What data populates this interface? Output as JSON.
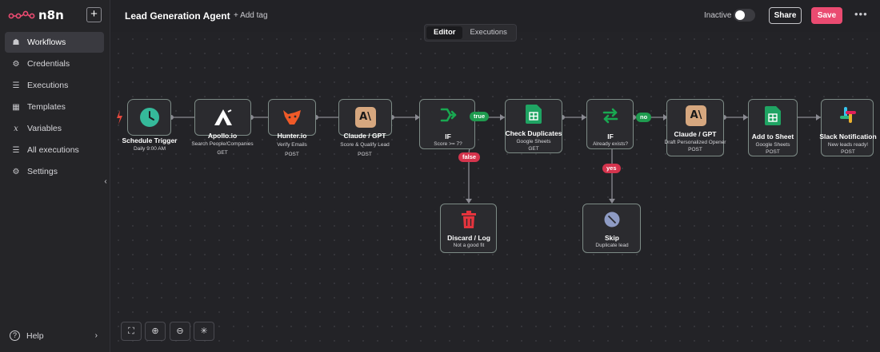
{
  "app": {
    "name": "n8n"
  },
  "sidebar": {
    "items": [
      {
        "label": "Workflows",
        "icon": "workflow-icon",
        "active": true
      },
      {
        "label": "Credentials",
        "icon": "key-icon"
      },
      {
        "label": "Executions",
        "icon": "list-icon"
      },
      {
        "label": "Templates",
        "icon": "template-icon"
      },
      {
        "label": "Variables",
        "icon": "variable-icon"
      },
      {
        "label": "All executions",
        "icon": "list-icon"
      },
      {
        "label": "Settings",
        "icon": "gear-icon"
      }
    ],
    "help": "Help"
  },
  "header": {
    "title": "Lead Generation Agent",
    "add_tag": "+ Add tag",
    "status": "Inactive",
    "share": "Share",
    "save": "Save"
  },
  "canvas": {
    "tabs": [
      {
        "label": "Editor",
        "active": true
      },
      {
        "label": "Executions"
      }
    ],
    "nodes": [
      {
        "id": "schedule",
        "label": "Schedule Trigger",
        "sub": "Daily 9:00 AM",
        "sub2": "",
        "icon": "clock-icon",
        "color": "#35b99a"
      },
      {
        "id": "apollo",
        "label": "Apollo.io",
        "sub": "Search People/Companies",
        "sub2": "GET",
        "icon": "apollo-logo-icon",
        "color": "#ffffff"
      },
      {
        "id": "hunter",
        "label": "Hunter.io",
        "sub": "Verify Emails",
        "sub2": "POST",
        "icon": "fox-icon",
        "color": "#f05a28"
      },
      {
        "id": "claude1",
        "label": "Claude / GPT",
        "sub": "Score & Qualify Lead",
        "sub2": "POST",
        "icon": "anthropic-icon",
        "color": "#d6a77f"
      },
      {
        "id": "if1",
        "label": "IF",
        "sub": "Score >= 7?",
        "sub2": "",
        "icon": "branch-icon",
        "color": "#19a851"
      },
      {
        "id": "dupes",
        "label": "Check Duplicates",
        "sub": "Google Sheets",
        "sub2": "GET",
        "icon": "sheets-icon",
        "color": "#1fa463"
      },
      {
        "id": "if2",
        "label": "IF",
        "sub": "Already exists?",
        "sub2": "",
        "icon": "branch-icon",
        "color": "#19a851"
      },
      {
        "id": "claude2",
        "label": "Claude / GPT",
        "sub": "Draft Personalized Opener",
        "sub2": "POST",
        "icon": "anthropic-icon",
        "color": "#d6a77f"
      },
      {
        "id": "addsheet",
        "label": "Add to Sheet",
        "sub": "Google Sheets",
        "sub2": "POST",
        "icon": "sheets-icon",
        "color": "#1fa463"
      },
      {
        "id": "slack",
        "label": "Slack Notification",
        "sub": "New leads ready!",
        "sub2": "POST",
        "icon": "slack-icon",
        "color": "#e01e5a"
      },
      {
        "id": "discard",
        "label": "Discard / Log",
        "sub": "Not a good fit",
        "sub2": "",
        "icon": "trash-icon",
        "color": "#e5343d"
      },
      {
        "id": "skip",
        "label": "Skip",
        "sub": "Duplicate lead",
        "sub2": "",
        "icon": "skip-icon",
        "color": "#8e9bc4"
      }
    ],
    "branch_labels": {
      "true": "true",
      "false": "false",
      "no": "no",
      "yes": "yes"
    }
  },
  "colors": {
    "accent": "#ea4b71",
    "success": "#1f9b4f",
    "danger": "#d5344d"
  }
}
